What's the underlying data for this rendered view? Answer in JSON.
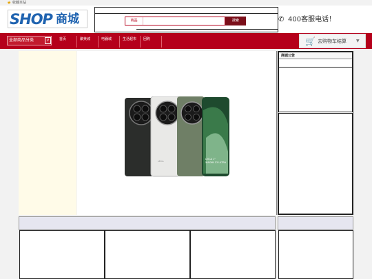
{
  "topbar": {
    "favorite_label": "收藏本站"
  },
  "logo": {
    "text_shop": "SHOP",
    "text_cn": "商城"
  },
  "search": {
    "category_label": "商品",
    "placeholder": "",
    "button_label": "搜索"
  },
  "hotline": {
    "label": "400客服电话！"
  },
  "nav": {
    "category_button": "全部商品分类",
    "category_arrow": "V",
    "items": [
      {
        "label": "首页"
      },
      {
        "label": "聚美城"
      },
      {
        "label": "电器城"
      },
      {
        "label": "生活超市"
      },
      {
        "label": "团购"
      }
    ]
  },
  "cart": {
    "label": "去购物车结算",
    "arrow": "▼"
  },
  "sidebar": {
    "notice_title": "商城公告"
  },
  "colors": {
    "brand_red": "#b5001b",
    "logo_blue": "#1f63b0",
    "button_dark_red": "#7b0f1a"
  },
  "banner": {
    "product_text": "LEICA 1\" XIAOMI 13 ULTRA"
  }
}
